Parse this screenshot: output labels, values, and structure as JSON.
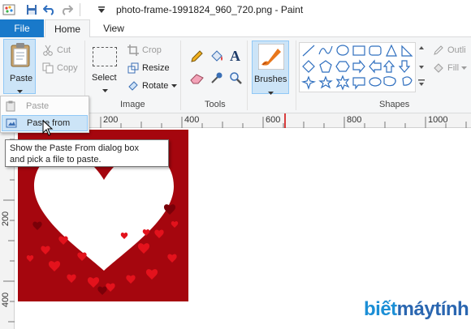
{
  "window": {
    "title": "photo-frame-1991824_960_720.png - Paint"
  },
  "quick_access": {
    "icons": [
      "paint-app-icon",
      "save-icon",
      "undo-icon",
      "redo-icon",
      "customize-dropdown-icon"
    ]
  },
  "tabs": {
    "file": "File",
    "home": "Home",
    "view": "View"
  },
  "ribbon": {
    "clipboard": {
      "paste": "Paste",
      "cut": "Cut",
      "copy": "Copy"
    },
    "image": {
      "select": "Select",
      "crop": "Crop",
      "resize": "Resize",
      "rotate": "Rotate",
      "group_label": "Image"
    },
    "tools": {
      "group_label": "Tools"
    },
    "brushes": {
      "label": "Brushes"
    },
    "shapes": {
      "group_label": "Shapes",
      "outline": "Outli",
      "fill": "Fill"
    }
  },
  "paste_menu": {
    "paste": "Paste",
    "paste_from": "Paste from"
  },
  "tooltip": {
    "line1": "Show the Paste From dialog box",
    "line2": "and pick a file to paste."
  },
  "ruler": {
    "horizontal_ticks": [
      "200",
      "400",
      "600",
      "800",
      "1000"
    ],
    "vertical_ticks": [
      "200",
      "400"
    ]
  },
  "watermark": {
    "part1": "biết",
    "part2": "máytính"
  },
  "colors": {
    "file_tab": "#1979ca",
    "image_background": "#a5060e",
    "brushes_active": "#cce4f7",
    "ruler_cursor": "#d00000"
  }
}
